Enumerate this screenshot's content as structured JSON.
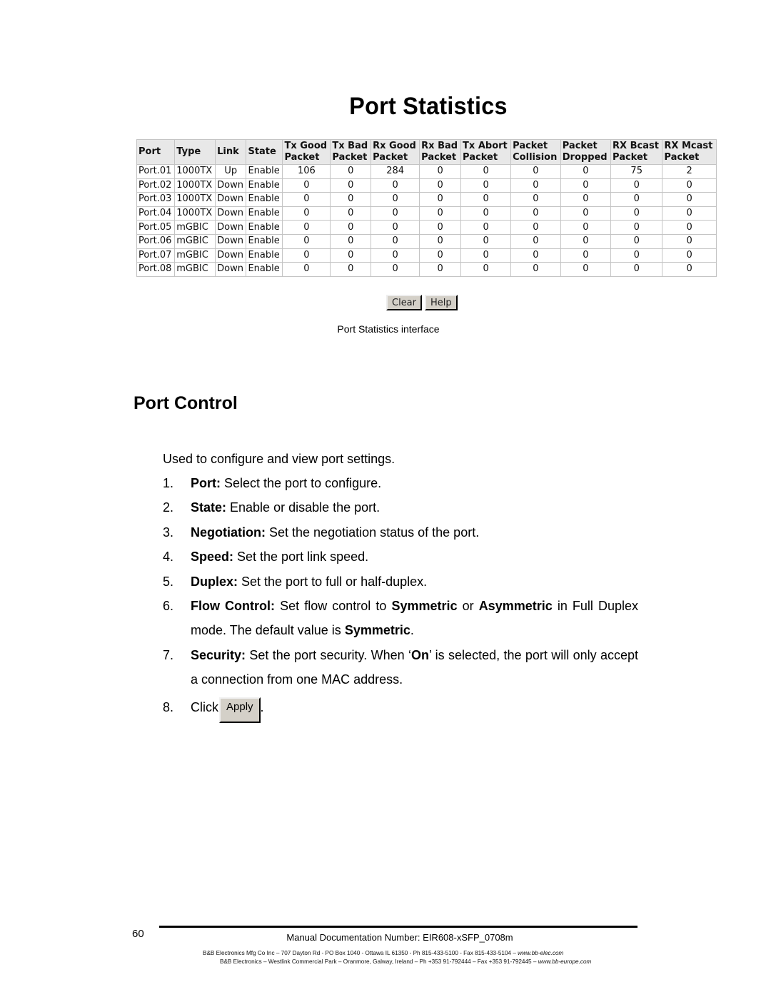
{
  "screenshot": {
    "title": "Port Statistics",
    "table": {
      "headers": [
        [
          "Port",
          ""
        ],
        [
          "Type",
          ""
        ],
        [
          "Link",
          ""
        ],
        [
          "State",
          ""
        ],
        [
          "Tx Good",
          "Packet"
        ],
        [
          "Tx Bad",
          "Packet"
        ],
        [
          "Rx Good",
          "Packet"
        ],
        [
          "Rx Bad",
          "Packet"
        ],
        [
          "Tx Abort",
          "Packet"
        ],
        [
          "Packet",
          "Collision"
        ],
        [
          "Packet",
          "Dropped"
        ],
        [
          "RX Bcast",
          "Packet"
        ],
        [
          "RX Mcast",
          "Packet"
        ]
      ],
      "rows": [
        [
          "Port.01",
          "1000TX",
          "Up",
          "Enable",
          "106",
          "0",
          "284",
          "0",
          "0",
          "0",
          "0",
          "75",
          "2"
        ],
        [
          "Port.02",
          "1000TX",
          "Down",
          "Enable",
          "0",
          "0",
          "0",
          "0",
          "0",
          "0",
          "0",
          "0",
          "0"
        ],
        [
          "Port.03",
          "1000TX",
          "Down",
          "Enable",
          "0",
          "0",
          "0",
          "0",
          "0",
          "0",
          "0",
          "0",
          "0"
        ],
        [
          "Port.04",
          "1000TX",
          "Down",
          "Enable",
          "0",
          "0",
          "0",
          "0",
          "0",
          "0",
          "0",
          "0",
          "0"
        ],
        [
          "Port.05",
          "mGBIC",
          "Down",
          "Enable",
          "0",
          "0",
          "0",
          "0",
          "0",
          "0",
          "0",
          "0",
          "0"
        ],
        [
          "Port.06",
          "mGBIC",
          "Down",
          "Enable",
          "0",
          "0",
          "0",
          "0",
          "0",
          "0",
          "0",
          "0",
          "0"
        ],
        [
          "Port.07",
          "mGBIC",
          "Down",
          "Enable",
          "0",
          "0",
          "0",
          "0",
          "0",
          "0",
          "0",
          "0",
          "0"
        ],
        [
          "Port.08",
          "mGBIC",
          "Down",
          "Enable",
          "0",
          "0",
          "0",
          "0",
          "0",
          "0",
          "0",
          "0",
          "0"
        ]
      ]
    },
    "buttons": {
      "clear": "Clear",
      "help": "Help"
    }
  },
  "caption": "Port Statistics interface",
  "section": {
    "title": "Port Control",
    "intro": "Used to configure and view port settings.",
    "steps": [
      {
        "num": "1.",
        "label": "Port:",
        "text": " Select the port to configure."
      },
      {
        "num": "2.",
        "label": "State:",
        "text": " Enable or disable the port."
      },
      {
        "num": "3.",
        "label": "Negotiation:",
        "text": " Set the negotiation status of the port."
      },
      {
        "num": "4.",
        "label": "Speed:",
        "text": " Set the port link speed."
      },
      {
        "num": "5.",
        "label": "Duplex:",
        "text": " Set the port to full or half-duplex."
      },
      {
        "num": "6.",
        "label": "Flow Control:",
        "t1": " Set flow control to ",
        "b1": "Symmetric",
        "t2": " or ",
        "b2": "Asymmetric",
        "t3": " in Full Duplex mode. The default value is ",
        "b3": "Symmetric",
        "t4": "."
      },
      {
        "num": "7.",
        "label": "Security:",
        "t1": " Set the port security. When ‘",
        "b1": "On",
        "t2": "’ is selected, the port will only accept a connection from one MAC address."
      },
      {
        "num": "8.",
        "text": "Click",
        "button": "Apply",
        "after": "."
      }
    ]
  },
  "footer": {
    "page_number": "60",
    "doc_number": "Manual Documentation Number: EIR608-xSFP_0708m",
    "address_us": "B&B Electronics Mfg Co Inc – 707 Dayton Rd - PO Box 1040 - Ottawa IL 61350 - Ph 815-433-5100 - Fax 815-433-5104 – ",
    "url_us": "www.bb-elec.com",
    "address_eu": "B&B Electronics – Westlink Commercial Park – Oranmore, Galway, Ireland – Ph +353 91-792444 – Fax +353 91-792445 – ",
    "url_eu": "www.bb-europe.com"
  }
}
